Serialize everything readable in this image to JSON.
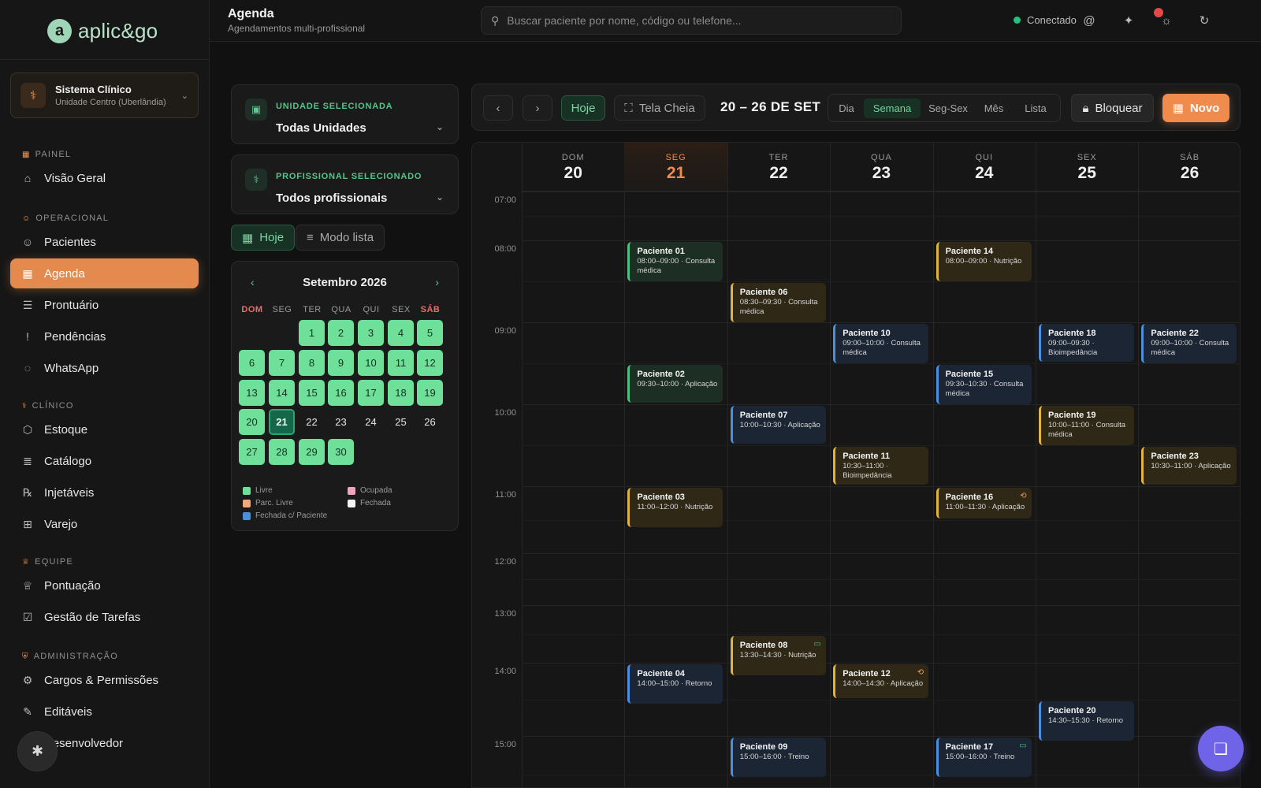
{
  "app": {
    "logo_mark": "a",
    "logo_text": "aplic&go"
  },
  "system": {
    "title": "Sistema Clínico",
    "subtitle": "Unidade Centro (Uberlândia)"
  },
  "nav": {
    "sections": [
      {
        "label": "PAINEL",
        "items": [
          {
            "label": "Visão Geral",
            "icon": "home-icon",
            "glyph": "⌂"
          }
        ]
      },
      {
        "label": "OPERACIONAL",
        "items": [
          {
            "label": "Pacientes",
            "icon": "users-icon",
            "glyph": "☺"
          },
          {
            "label": "Agenda",
            "icon": "calendar-icon",
            "glyph": "▦"
          },
          {
            "label": "Prontuário",
            "icon": "clipboard-icon",
            "glyph": "☰"
          },
          {
            "label": "Pendências",
            "icon": "alert-icon",
            "glyph": "!"
          },
          {
            "label": "WhatsApp",
            "icon": "whatsapp-icon",
            "glyph": "◌"
          }
        ]
      },
      {
        "label": "CLÍNICO",
        "items": [
          {
            "label": "Estoque",
            "icon": "box-icon",
            "glyph": "⬡"
          },
          {
            "label": "Catálogo",
            "icon": "catalog-icon",
            "glyph": "≣"
          },
          {
            "label": "Injetáveis",
            "icon": "prescription-icon",
            "glyph": "℞"
          },
          {
            "label": "Varejo",
            "icon": "cart-icon",
            "glyph": "⊞"
          }
        ]
      },
      {
        "label": "EQUIPE",
        "items": [
          {
            "label": "Pontuação",
            "icon": "trophy-icon",
            "glyph": "♕"
          },
          {
            "label": "Gestão de Tarefas",
            "icon": "tasks-icon",
            "glyph": "☑"
          }
        ]
      },
      {
        "label": "ADMINISTRAÇÃO",
        "items": [
          {
            "label": "Cargos & Permissões",
            "icon": "gear-users-icon",
            "glyph": "⚙"
          },
          {
            "label": "Editáveis",
            "icon": "edit-icon",
            "glyph": "✎"
          },
          {
            "label": "Desenvolvedor",
            "icon": "code-icon",
            "glyph": "⌘"
          }
        ]
      }
    ],
    "active": "Agenda"
  },
  "header": {
    "title": "Agenda",
    "subtitle": "Agendamentos multi-profissional",
    "search_placeholder": "Buscar paciente por nome, código ou telefone...",
    "status": "Conectado"
  },
  "filters": {
    "unit_label": "UNIDADE SELECIONADA",
    "unit_value": "Todas Unidades",
    "prof_label": "PROFISSIONAL SELECIONADO",
    "prof_value": "Todos profissionais",
    "today_btn": "Hoje",
    "list_btn": "Modo lista"
  },
  "mini_calendar": {
    "title": "Setembro 2026",
    "weekdays": [
      "DOM",
      "SEG",
      "TER",
      "QUA",
      "QUI",
      "SEX",
      "SÁB"
    ],
    "first_weekday": 2,
    "days": 30,
    "today": 21,
    "free_days": [
      1,
      2,
      3,
      4,
      5,
      6,
      7,
      8,
      9,
      10,
      11,
      12,
      13,
      14,
      15,
      16,
      17,
      18,
      19,
      20,
      27,
      28,
      29,
      30
    ],
    "legend": [
      {
        "label": "Livre",
        "color": "#6ee09a"
      },
      {
        "label": "Ocupada",
        "color": "#f0a3c0"
      },
      {
        "label": "Parc. Livre",
        "color": "#f5a978"
      },
      {
        "label": "Fechada",
        "color": "#f3f3f3"
      },
      {
        "label": "Fechada c/ Paciente",
        "color": "#4b8fe0"
      }
    ]
  },
  "toolbar": {
    "prev": "‹",
    "next": "›",
    "today": "Hoje",
    "fullscreen": "Tela Cheia",
    "range": "20 – 26 DE SET",
    "views": [
      "Dia",
      "Semana",
      "Seg-Sex",
      "Mês",
      "Lista"
    ],
    "active_view": "Semana",
    "block": "Bloquear",
    "new": "Novo"
  },
  "week": {
    "days": [
      {
        "dow": "DOM",
        "num": "20"
      },
      {
        "dow": "SEG",
        "num": "21"
      },
      {
        "dow": "TER",
        "num": "22"
      },
      {
        "dow": "QUA",
        "num": "23"
      },
      {
        "dow": "QUI",
        "num": "24"
      },
      {
        "dow": "SEX",
        "num": "25"
      },
      {
        "dow": "SÁB",
        "num": "26"
      }
    ],
    "today_index": 1,
    "hours": [
      "07:00",
      "08:00",
      "09:00",
      "10:00",
      "11:00",
      "12:00",
      "13:00",
      "14:00",
      "15:00"
    ],
    "events": [
      {
        "day": 1,
        "start": 8.0,
        "end": 9.0,
        "name": "Paciente 01",
        "detail": "08:00–09:00 · Consulta médica",
        "color": "green"
      },
      {
        "day": 1,
        "start": 9.5,
        "end": 10.0,
        "name": "Paciente 02",
        "detail": "09:30–10:00 · Aplicação",
        "color": "green"
      },
      {
        "day": 1,
        "start": 11.0,
        "end": 12.0,
        "name": "Paciente 03",
        "detail": "11:00–12:00 · Nutrição",
        "color": "yellow"
      },
      {
        "day": 1,
        "start": 14.0,
        "end": 15.0,
        "name": "Paciente 04",
        "detail": "14:00–15:00 · Retorno",
        "color": "blue"
      },
      {
        "day": 2,
        "start": 8.5,
        "end": 9.5,
        "name": "Paciente 06",
        "detail": "08:30–09:30 · Consulta médica",
        "color": "yellow"
      },
      {
        "day": 2,
        "start": 10.0,
        "end": 10.5,
        "name": "Paciente 07",
        "detail": "10:00–10:30 · Aplicação",
        "color": "blue"
      },
      {
        "day": 2,
        "start": 13.5,
        "end": 14.5,
        "name": "Paciente 08",
        "detail": "13:30–14:30 · Nutrição",
        "color": "yellow",
        "icon": "video-icon"
      },
      {
        "day": 2,
        "start": 15.0,
        "end": 16.0,
        "name": "Paciente 09",
        "detail": "15:00–16:00 · Treino",
        "color": "blue"
      },
      {
        "day": 3,
        "start": 9.0,
        "end": 10.0,
        "name": "Paciente 10",
        "detail": "09:00–10:00 · Consulta médica",
        "color": "blue"
      },
      {
        "day": 3,
        "start": 10.5,
        "end": 11.0,
        "name": "Paciente 11",
        "detail": "10:30–11:00 · Bioimpedância",
        "color": "yellow"
      },
      {
        "day": 3,
        "start": 14.0,
        "end": 14.5,
        "name": "Paciente 12",
        "detail": "14:00–14:30 · Aplicação",
        "color": "yellow",
        "icon": "repeat-icon"
      },
      {
        "day": 4,
        "start": 8.0,
        "end": 9.0,
        "name": "Paciente 14",
        "detail": "08:00–09:00 · Nutrição",
        "color": "yellow"
      },
      {
        "day": 4,
        "start": 9.5,
        "end": 10.5,
        "name": "Paciente 15",
        "detail": "09:30–10:30 · Consulta médica",
        "color": "blue"
      },
      {
        "day": 4,
        "start": 11.0,
        "end": 11.5,
        "name": "Paciente 16",
        "detail": "11:00–11:30 · Aplicação",
        "color": "yellow",
        "icon": "repeat-icon"
      },
      {
        "day": 4,
        "start": 15.0,
        "end": 16.0,
        "name": "Paciente 17",
        "detail": "15:00–16:00 · Treino",
        "color": "blue",
        "icon": "video-icon"
      },
      {
        "day": 5,
        "start": 9.0,
        "end": 9.5,
        "name": "Paciente 18",
        "detail": "09:00–09:30 · Bioimpedância",
        "color": "blue"
      },
      {
        "day": 5,
        "start": 10.0,
        "end": 11.0,
        "name": "Paciente 19",
        "detail": "10:00–11:00 · Consulta médica",
        "color": "yellow"
      },
      {
        "day": 5,
        "start": 14.5,
        "end": 15.5,
        "name": "Paciente 20",
        "detail": "14:30–15:30 · Retorno",
        "color": "blue"
      },
      {
        "day": 6,
        "start": 9.0,
        "end": 10.0,
        "name": "Paciente 22",
        "detail": "09:00–10:00 · Consulta médica",
        "color": "blue"
      },
      {
        "day": 6,
        "start": 10.5,
        "end": 11.0,
        "name": "Paciente 23",
        "detail": "10:30–11:00 · Aplicação",
        "color": "yellow"
      }
    ]
  }
}
